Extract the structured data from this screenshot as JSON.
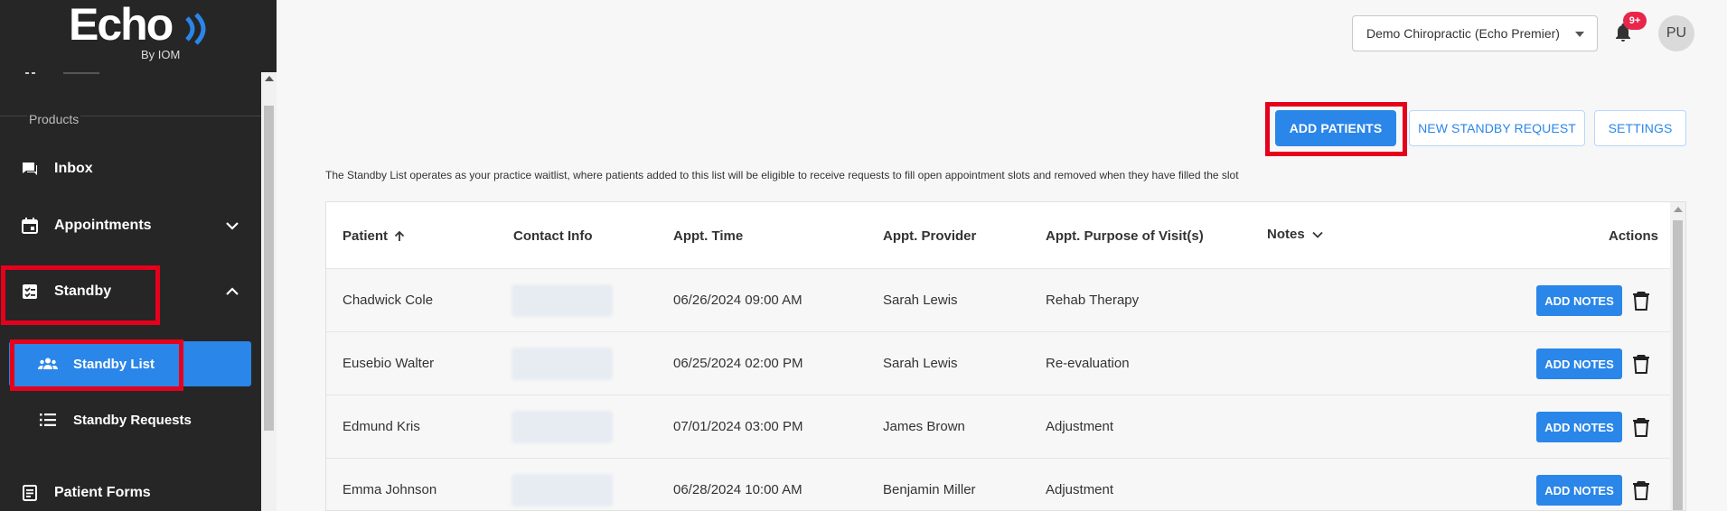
{
  "brand": {
    "name": "Echo",
    "sub": "By IOM"
  },
  "sidebar": {
    "section_label": "Products",
    "items": [
      {
        "label": "Inbox",
        "icon": "inbox-icon"
      },
      {
        "label": "Appointments",
        "icon": "calendar-icon"
      },
      {
        "label": "Standby",
        "icon": "checklist-icon"
      },
      {
        "label": "Patient Forms",
        "icon": "form-icon"
      }
    ],
    "sub_items": [
      {
        "label": "Standby List",
        "icon": "group-icon",
        "active": true
      },
      {
        "label": "Standby Requests",
        "icon": "list-icon",
        "active": false
      }
    ]
  },
  "header": {
    "practice": "Demo Chiropractic (Echo Premier)",
    "notifications_badge": "9+",
    "avatar_initials": "PU"
  },
  "actions": {
    "add_patients": "ADD PATIENTS",
    "new_standby_request": "NEW STANDBY REQUEST",
    "settings": "SETTINGS"
  },
  "description": "The Standby List operates as your practice waitlist, where patients added to this list will be eligible to receive requests to fill open appointment slots and removed when they have filled the slot",
  "table": {
    "columns": {
      "patient": "Patient",
      "contact": "Contact Info",
      "time": "Appt. Time",
      "provider": "Appt. Provider",
      "purpose": "Appt. Purpose of Visit(s)",
      "notes": "Notes",
      "actions": "Actions"
    },
    "row_button": "ADD NOTES",
    "rows": [
      {
        "patient": "Chadwick Cole",
        "time": "06/26/2024 09:00 AM",
        "provider": "Sarah Lewis",
        "purpose": "Rehab Therapy"
      },
      {
        "patient": "Eusebio Walter",
        "time": "06/25/2024 02:00 PM",
        "provider": "Sarah Lewis",
        "purpose": "Re-evaluation"
      },
      {
        "patient": "Edmund Kris",
        "time": "07/01/2024 03:00 PM",
        "provider": "James Brown",
        "purpose": "Adjustment"
      },
      {
        "patient": "Emma Johnson",
        "time": "06/28/2024 10:00 AM",
        "provider": "Benjamin Miller",
        "purpose": "Adjustment"
      }
    ]
  },
  "colors": {
    "accent": "#2a86e8",
    "highlight": "#e5001c",
    "sidebar": "#262626",
    "badge": "#e8264a"
  }
}
